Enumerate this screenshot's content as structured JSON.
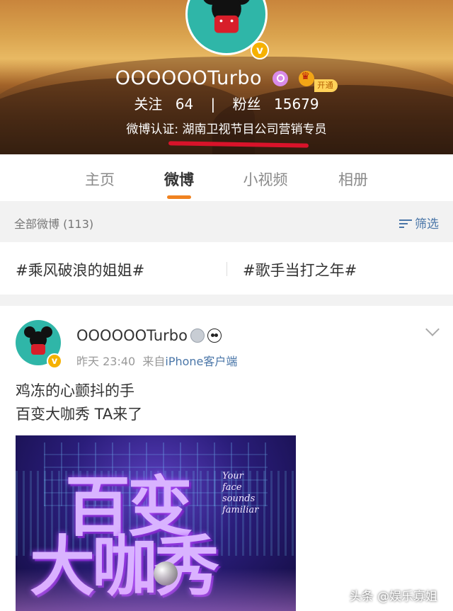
{
  "profile": {
    "name": "OOOOOOTurbo",
    "vip_label": "开通",
    "following_label": "关注",
    "following_count": "64",
    "separator": "|",
    "followers_label": "粉丝",
    "followers_count": "15679",
    "verification": "微博认证: 湖南卫视节目公司营销专员",
    "verified_badge": "v"
  },
  "tabs": [
    {
      "label": "主页",
      "active": false
    },
    {
      "label": "微博",
      "active": true
    },
    {
      "label": "小视频",
      "active": false
    },
    {
      "label": "相册",
      "active": false
    }
  ],
  "filter_bar": {
    "all_posts": "全部微博 (113)",
    "filter_label": "筛选"
  },
  "topics": [
    "#乘风破浪的姐姐#",
    "#歌手当打之年#"
  ],
  "post": {
    "author": "OOOOOOTurbo",
    "time": "昨天 23:40",
    "source_prefix": "来自",
    "source": "iPhone客户端",
    "text_line1": "鸡冻的心颤抖的手",
    "text_line2": "百变大咖秀 TA来了",
    "image_title_line1": "百变",
    "image_title_line2": "大咖秀",
    "image_side_text": "Your face sounds familiar"
  },
  "watermark": "头条 @娱乐寡姐",
  "colors": {
    "accent_orange": "#f08220",
    "link_blue": "#4a76a8",
    "verify_gold": "#f6b100",
    "highlight_red": "#d8132a"
  }
}
